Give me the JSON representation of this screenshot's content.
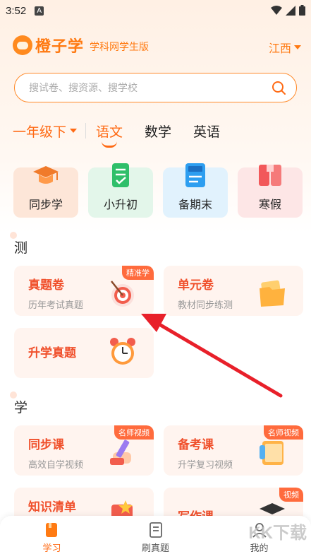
{
  "status_bar": {
    "time": "3:52",
    "notification_letter": "A"
  },
  "header": {
    "app_name": "橙子学",
    "subtitle": "学科网学生版",
    "region": "江西"
  },
  "search": {
    "placeholder": "搜试卷、搜资源、搜学校"
  },
  "subjects": {
    "grade": "一年级下",
    "items": [
      "语文",
      "数学",
      "英语"
    ],
    "active": "语文"
  },
  "quick_actions": [
    {
      "label": "同步学",
      "icon": "graduation-cap-icon",
      "bg": "#fde6d8"
    },
    {
      "label": "小升初",
      "icon": "checklist-icon",
      "bg": "#e3f6ea"
    },
    {
      "label": "备期末",
      "icon": "exam-paper-icon",
      "bg": "#e1f2fd"
    },
    {
      "label": "寒假",
      "icon": "book-icon",
      "bg": "#fde6e6"
    }
  ],
  "sections": {
    "test": {
      "title": "测",
      "cards": [
        {
          "title": "真题卷",
          "sub": "历年考试真题",
          "tag": "精准学",
          "icon": "target-icon"
        },
        {
          "title": "单元卷",
          "sub": "教材同步练测",
          "tag": "",
          "icon": "folder-icon"
        },
        {
          "title": "升学真题",
          "sub": "",
          "tag": "",
          "icon": "alarm-clock-icon"
        }
      ]
    },
    "learn": {
      "title": "学",
      "cards": [
        {
          "title": "同步课",
          "sub": "高效自学视频",
          "tag": "名师视频",
          "icon": "pencil-hand-icon"
        },
        {
          "title": "备考课",
          "sub": "升学复习视频",
          "tag": "名师视频",
          "icon": "notebook-icon"
        },
        {
          "title": "知识清单",
          "sub": "",
          "tag": "",
          "icon": "star-book-icon"
        },
        {
          "title": "写作课",
          "sub": "",
          "tag": "视频",
          "icon": "cap-book-icon"
        }
      ]
    }
  },
  "bottom_nav": {
    "items": [
      "学习",
      "刷真题",
      "我的"
    ],
    "active": "学习"
  },
  "watermark": "KK下载",
  "colors": {
    "accent": "#ff6a14",
    "card_title": "#f0502c",
    "arrow": "#e8202a"
  }
}
